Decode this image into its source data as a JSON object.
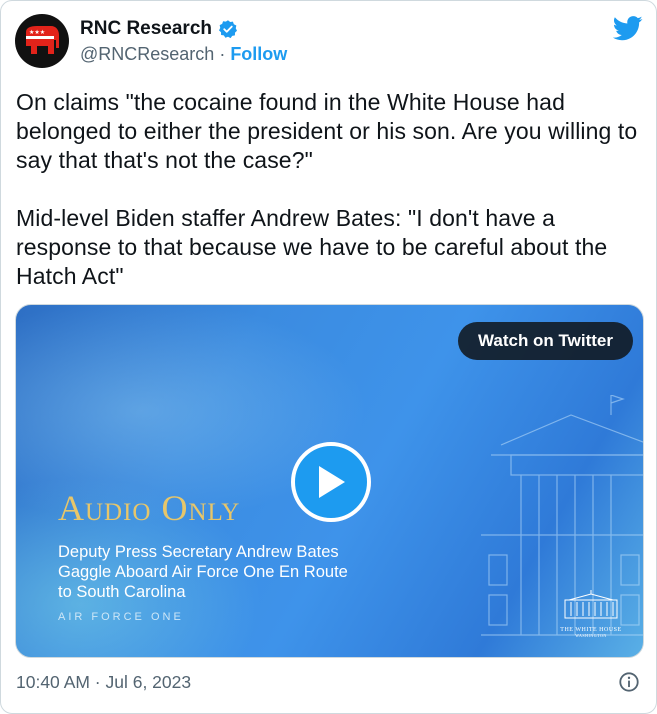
{
  "tweet": {
    "author_name": "RNC Research",
    "handle": "@RNCResearch",
    "separator": " · ",
    "follow_label": "Follow",
    "text": "On claims \"the cocaine found in the White House had belonged to either the president or his son. Are you willing to say that that's not the case?\"\n\nMid-level Biden staffer Andrew Bates: \"I don't have a response to that because we have to be careful about the Hatch Act\"",
    "timestamp": "10:40 AM · Jul 6, 2023"
  },
  "media": {
    "watch_label": "Watch on Twitter",
    "title": "Audio Only",
    "subtitle": "Deputy Press Secretary Andrew Bates\nGaggle Aboard Air Force One En Route\nto South Carolina",
    "caption": "AIR FORCE ONE",
    "logo_title": "THE WHITE HOUSE",
    "logo_sub": "WASHINGTON"
  },
  "icons": {
    "avatar": "rnc-elephant-logo",
    "verified": "verified-badge-icon",
    "platform": "twitter-bird-icon",
    "play": "play-icon",
    "info": "info-icon"
  },
  "colors": {
    "accent": "#1d9bf0",
    "avatar_red": "#e2231a",
    "audio_title": "#e7c66a"
  }
}
